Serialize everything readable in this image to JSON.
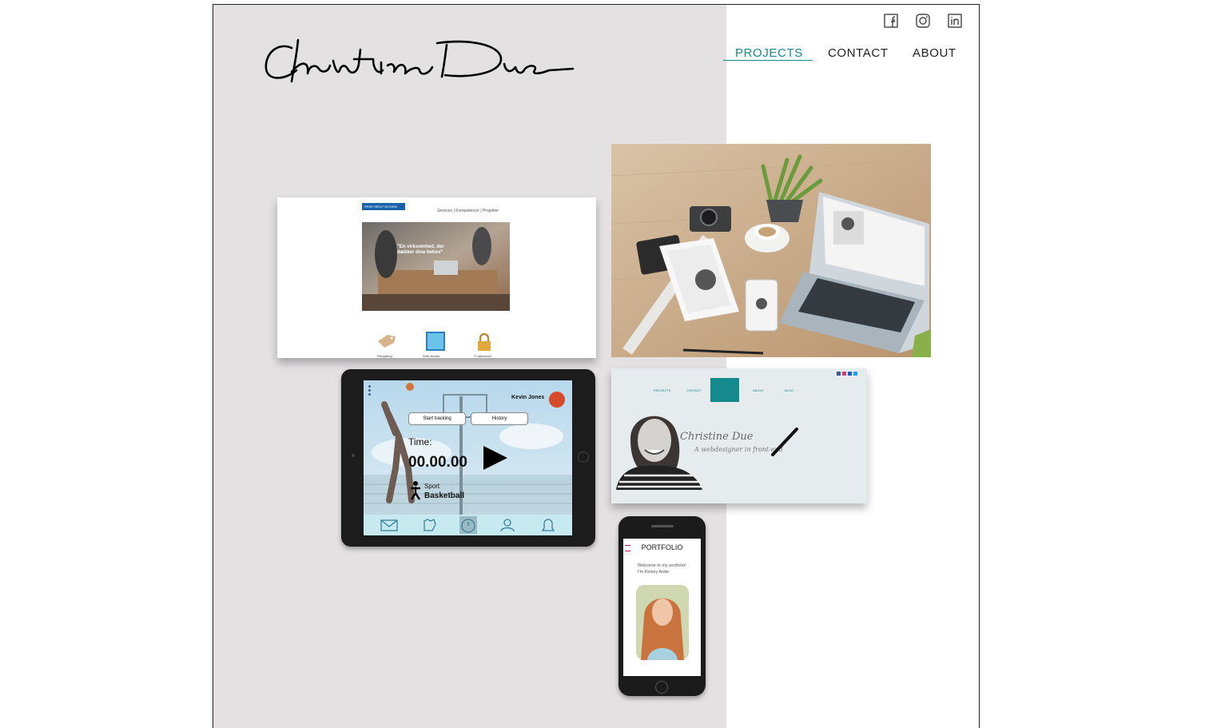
{
  "site": {
    "logo_text": "Christine Due",
    "social": [
      "facebook-icon",
      "instagram-icon",
      "linkedin-icon"
    ],
    "accent_color": "#14898e",
    "panel_color": "#e3e1e2"
  },
  "nav": {
    "items": [
      {
        "label": "PROJECTS",
        "active": true
      },
      {
        "label": "CONTACT",
        "active": false
      },
      {
        "label": "ABOUT",
        "active": false
      }
    ]
  },
  "project1": {
    "badge": "SPIELTREUT DESIGN",
    "nav": [
      "Services",
      "Kompetencer",
      "Projekter"
    ],
    "hero_text": "\"En virksomhed, der dækker dine behov\"",
    "features": [
      "Rengøring",
      "Web studier",
      "IT-sikkerhed"
    ]
  },
  "project2": {
    "user": "Kevin Jones",
    "tab1": "Start tracking",
    "tab2": "History",
    "time_label": "Time:",
    "time_value": "00.00.00",
    "sport_label": "Sport",
    "sport_value": "Basketball"
  },
  "project4": {
    "nav": [
      "PROJECTS",
      "CONTACT",
      "ABOUT",
      "BLOG"
    ],
    "signature": "Christine Due",
    "tagline": "A webdesigner in front-end"
  },
  "project5": {
    "title": "PORTFOLIO",
    "welcome": "Welcome to my portfolio! I'm Kelsey Ande"
  }
}
